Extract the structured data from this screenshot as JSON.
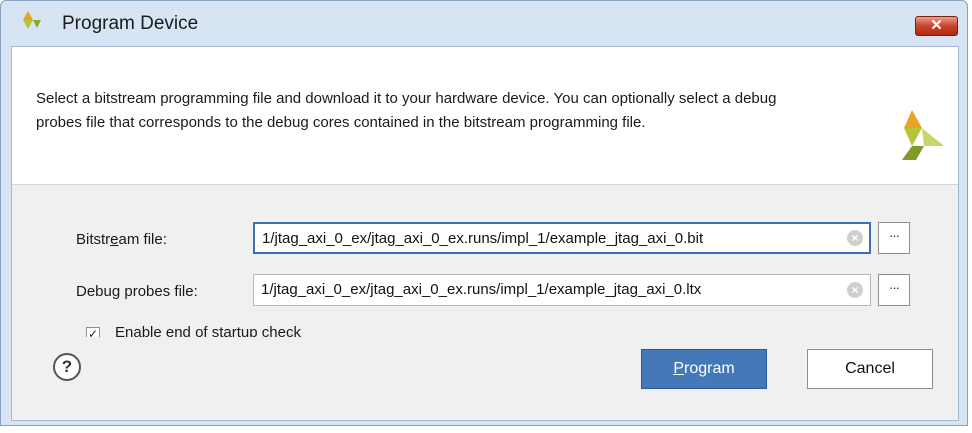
{
  "window": {
    "title": "Program Device",
    "close_label": "✕"
  },
  "header": {
    "description": "Select a bitstream programming file and download it to your hardware device. You can optionally select a debug probes file that corresponds to the debug cores contained in the bitstream programming file."
  },
  "form": {
    "bitstream": {
      "label_pre": "Bitstr",
      "label_mnemonic": "e",
      "label_post": "am file:",
      "value": "1/jtag_axi_0_ex/jtag_axi_0_ex.runs/impl_1/example_jtag_axi_0.bit"
    },
    "probes": {
      "label_pre": "Debu",
      "label_mnemonic": "g",
      "label_post": " probes file:",
      "value": "1/jtag_axi_0_ex/jtag_axi_0_ex.runs/impl_1/example_jtag_axi_0.ltx"
    },
    "browse_label": "···",
    "clear_glyph": "×",
    "startup_check": {
      "checked": true,
      "check_glyph": "✓",
      "label": "Enable end of startup check"
    }
  },
  "footer": {
    "help_label": "?",
    "program_mnemonic": "P",
    "program_rest": "rogram",
    "cancel_label": "Cancel"
  },
  "colors": {
    "window_frame": "#d6e4f4",
    "primary_button": "#4478b8",
    "focus_border": "#3d6fb6",
    "close_button": "#c8432b"
  }
}
